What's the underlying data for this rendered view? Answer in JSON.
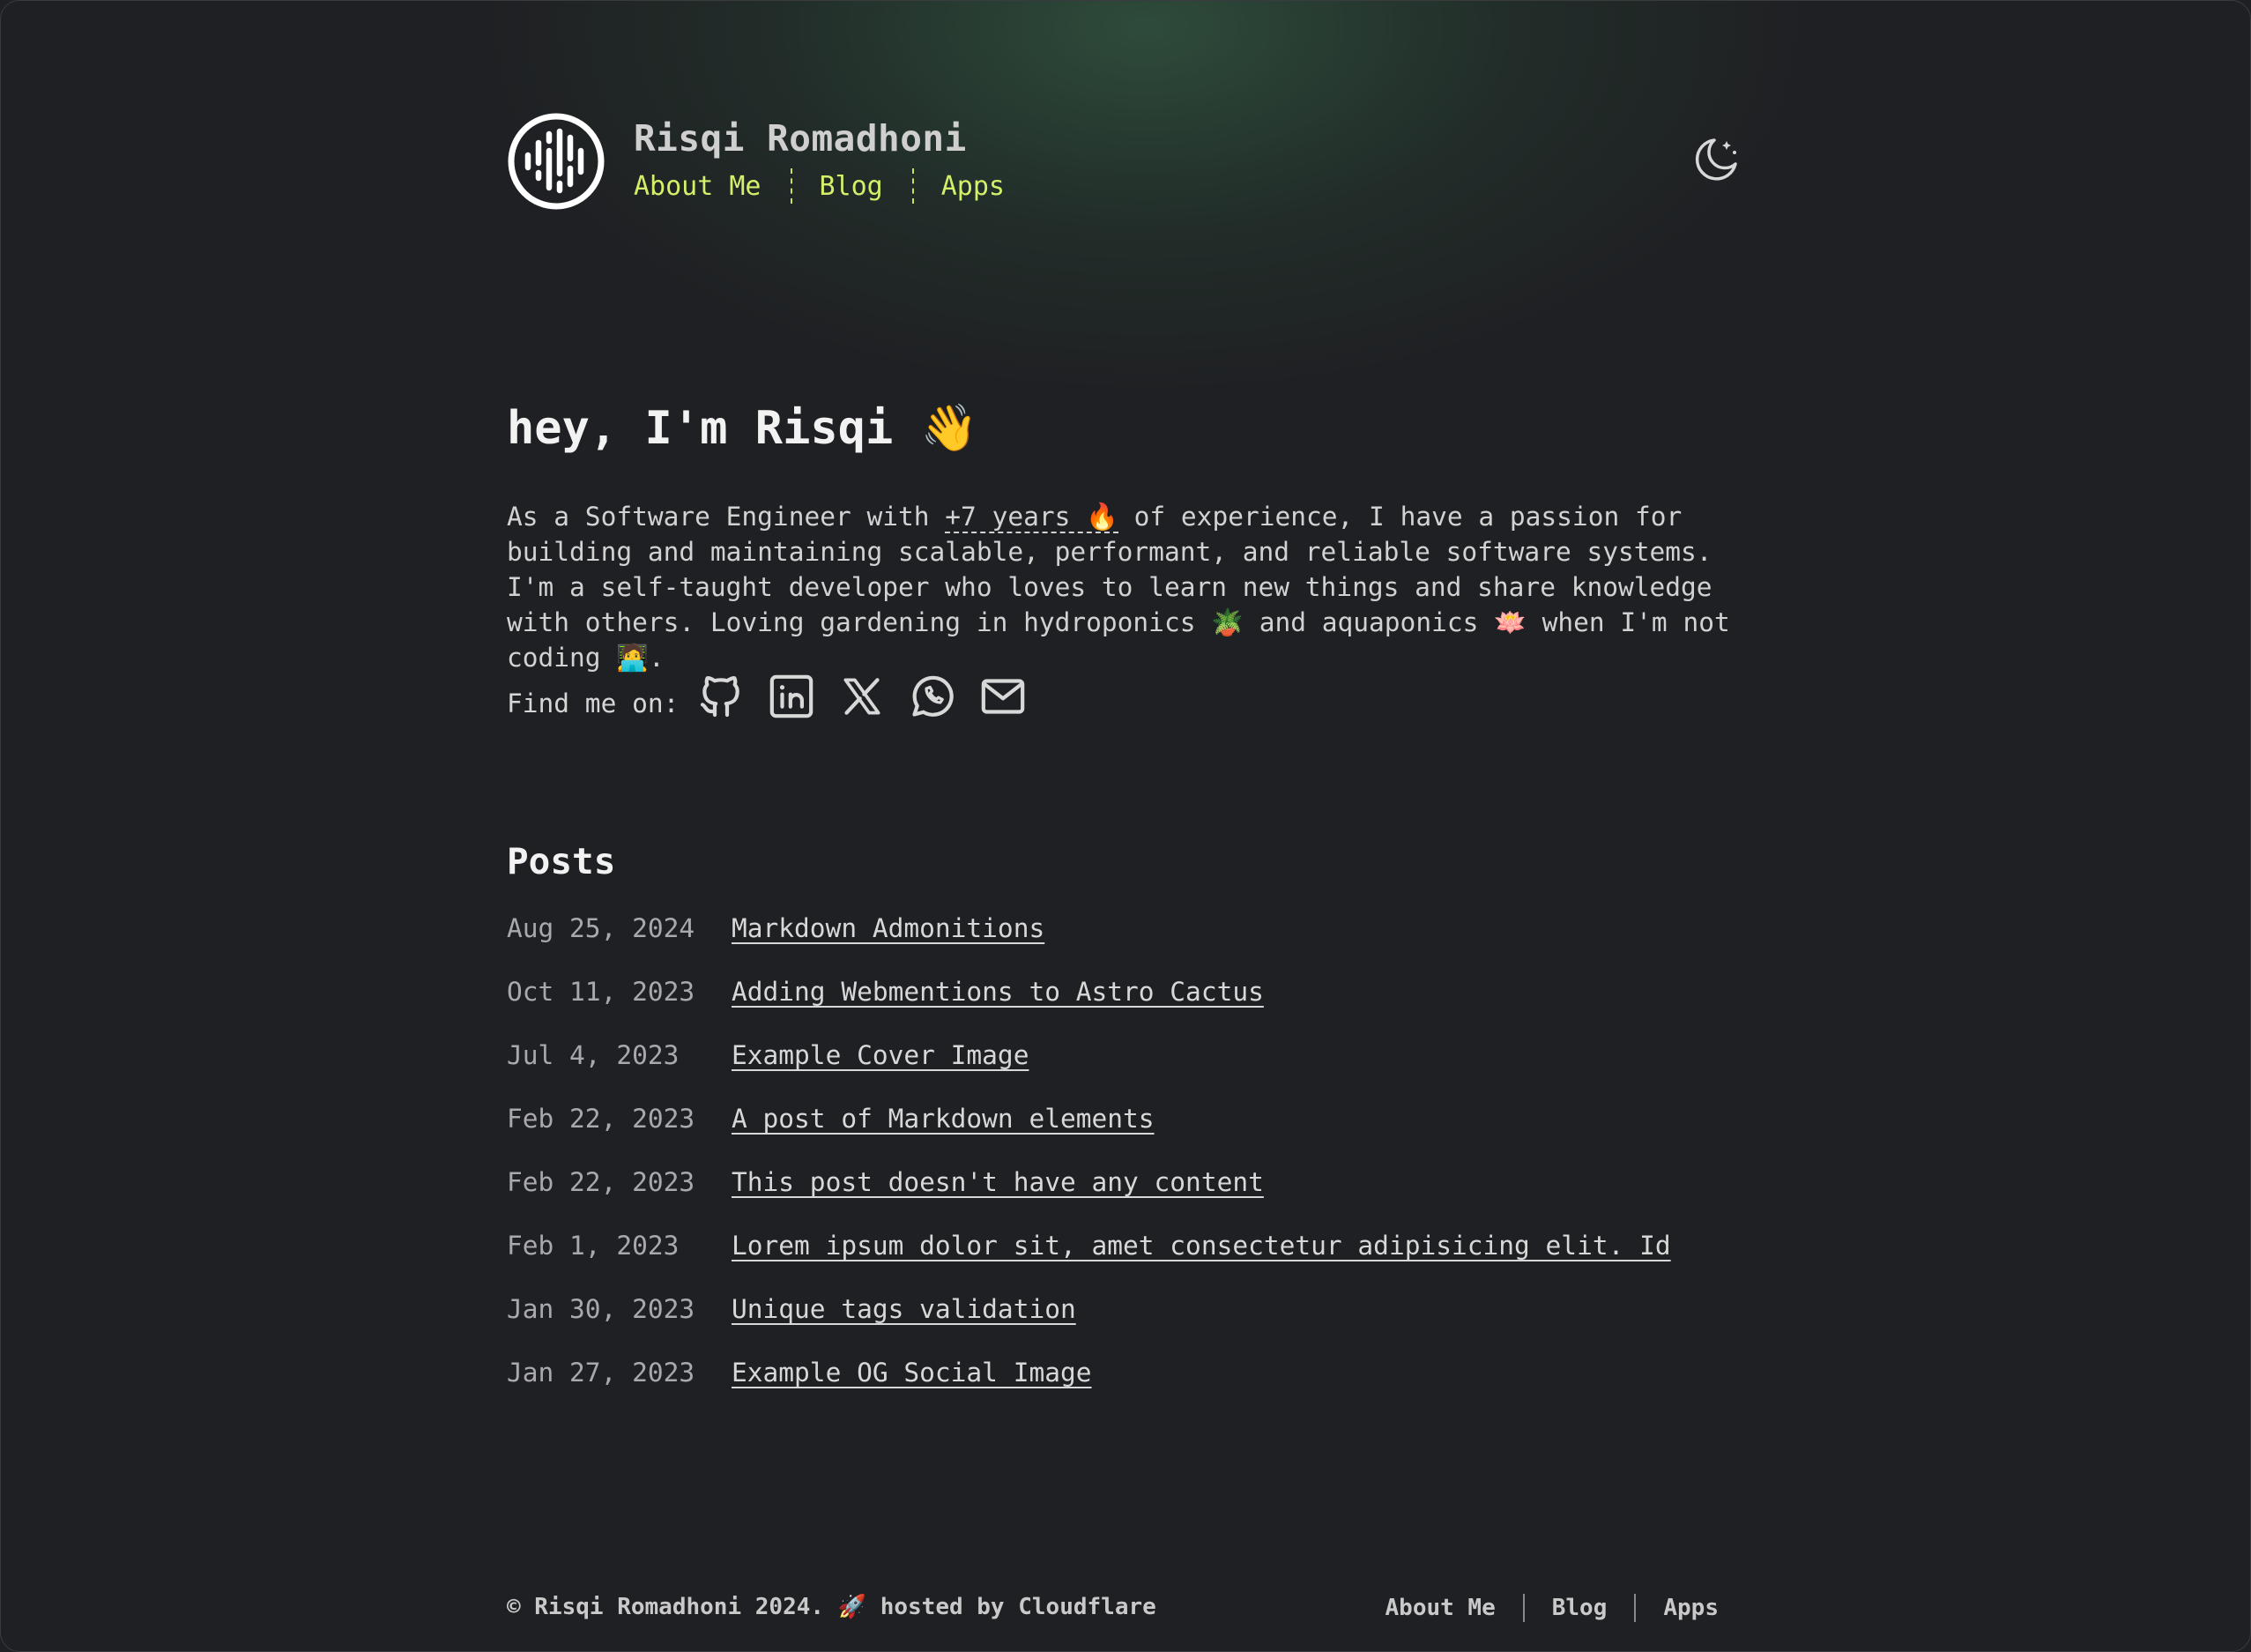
{
  "site": {
    "title": "Risqi Romadhoni"
  },
  "nav": {
    "items": [
      {
        "label": "About Me"
      },
      {
        "label": "Blog"
      },
      {
        "label": "Apps"
      }
    ]
  },
  "theme_toggle": {
    "icon": "moon-icon"
  },
  "intro": {
    "heading": "hey, I'm Risqi 👋",
    "text_before_years": "As a Software Engineer with ",
    "years": "+7 years 🔥",
    "text_after_years": " of experience, I have a passion for building and maintaining scalable, performant, and reliable software systems. I'm a self-taught developer who loves to learn new things and share knowledge with others. Loving gardening in hydroponics 🪴 and aquaponics 🪷 when I'm not coding 🧑‍💻.",
    "find_me_label": "Find me on:",
    "social_icons": [
      "github-icon",
      "linkedin-icon",
      "x-icon",
      "whatsapp-icon",
      "mail-icon"
    ]
  },
  "posts": {
    "heading": "Posts",
    "items": [
      {
        "date": "Aug 25, 2024",
        "title": "Markdown Admonitions"
      },
      {
        "date": "Oct 11, 2023",
        "title": "Adding Webmentions to Astro Cactus"
      },
      {
        "date": "Jul 4, 2023",
        "title": "Example Cover Image"
      },
      {
        "date": "Feb 22, 2023",
        "title": "A post of Markdown elements"
      },
      {
        "date": "Feb 22, 2023",
        "title": "This post doesn't have any content"
      },
      {
        "date": "Feb 1, 2023",
        "title": "Lorem ipsum dolor sit, amet consectetur adipisicing elit. Id"
      },
      {
        "date": "Jan 30, 2023",
        "title": "Unique tags validation"
      },
      {
        "date": "Jan 27, 2023",
        "title": "Example OG Social Image"
      }
    ]
  },
  "footer": {
    "copyright": "© Risqi Romadhoni 2024. 🚀 hosted by Cloudflare",
    "nav": [
      {
        "label": "About Me"
      },
      {
        "label": "Blog"
      },
      {
        "label": "Apps"
      }
    ]
  },
  "colors": {
    "background": "#1f2023",
    "accent": "#d4f06a",
    "text": "#d6d6d6",
    "heading": "#f2f2f2"
  }
}
